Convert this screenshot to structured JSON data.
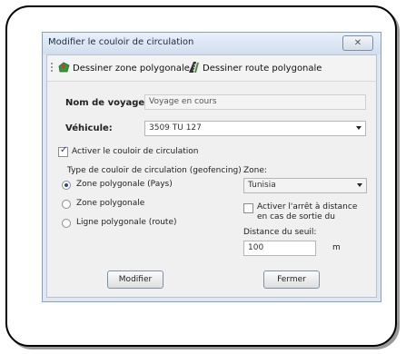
{
  "window": {
    "title": "Modifier le couloir de circulation",
    "close_label": "✕"
  },
  "toolbar": {
    "draw_zone_label": "Dessiner zone polygonale",
    "draw_route_label": "Dessiner route polygonale"
  },
  "form": {
    "trip_name_label": "Nom de voyage:",
    "trip_name_value": "Voyage en cours",
    "vehicle_label": "Véhicule:",
    "vehicle_value": "3509 TU 127",
    "activate_corridor_label": "Activer le couloir de circulation",
    "activate_corridor_checked": true,
    "corridor_type_label": "Type de couloir de circulation (geofencing)",
    "corridor_types": [
      {
        "label": "Zone polygonale (Pays)",
        "selected": true
      },
      {
        "label": "Zone polygonale",
        "selected": false
      },
      {
        "label": "Ligne polygonale (route)",
        "selected": false
      }
    ],
    "zone_label": "Zone:",
    "zone_value": "Tunisia",
    "stop_on_exit_line1": "Activer l'arrêt à distance",
    "stop_on_exit_line2": "en cas de sortie du",
    "stop_on_exit_checked": false,
    "threshold_label": "Distance du seuil:",
    "threshold_value": "100",
    "threshold_unit": "m"
  },
  "buttons": {
    "modify_label": "Modifier",
    "close_label": "Fermer"
  },
  "icons": {
    "zone": "polygon-zone-icon",
    "route": "road-route-icon"
  }
}
